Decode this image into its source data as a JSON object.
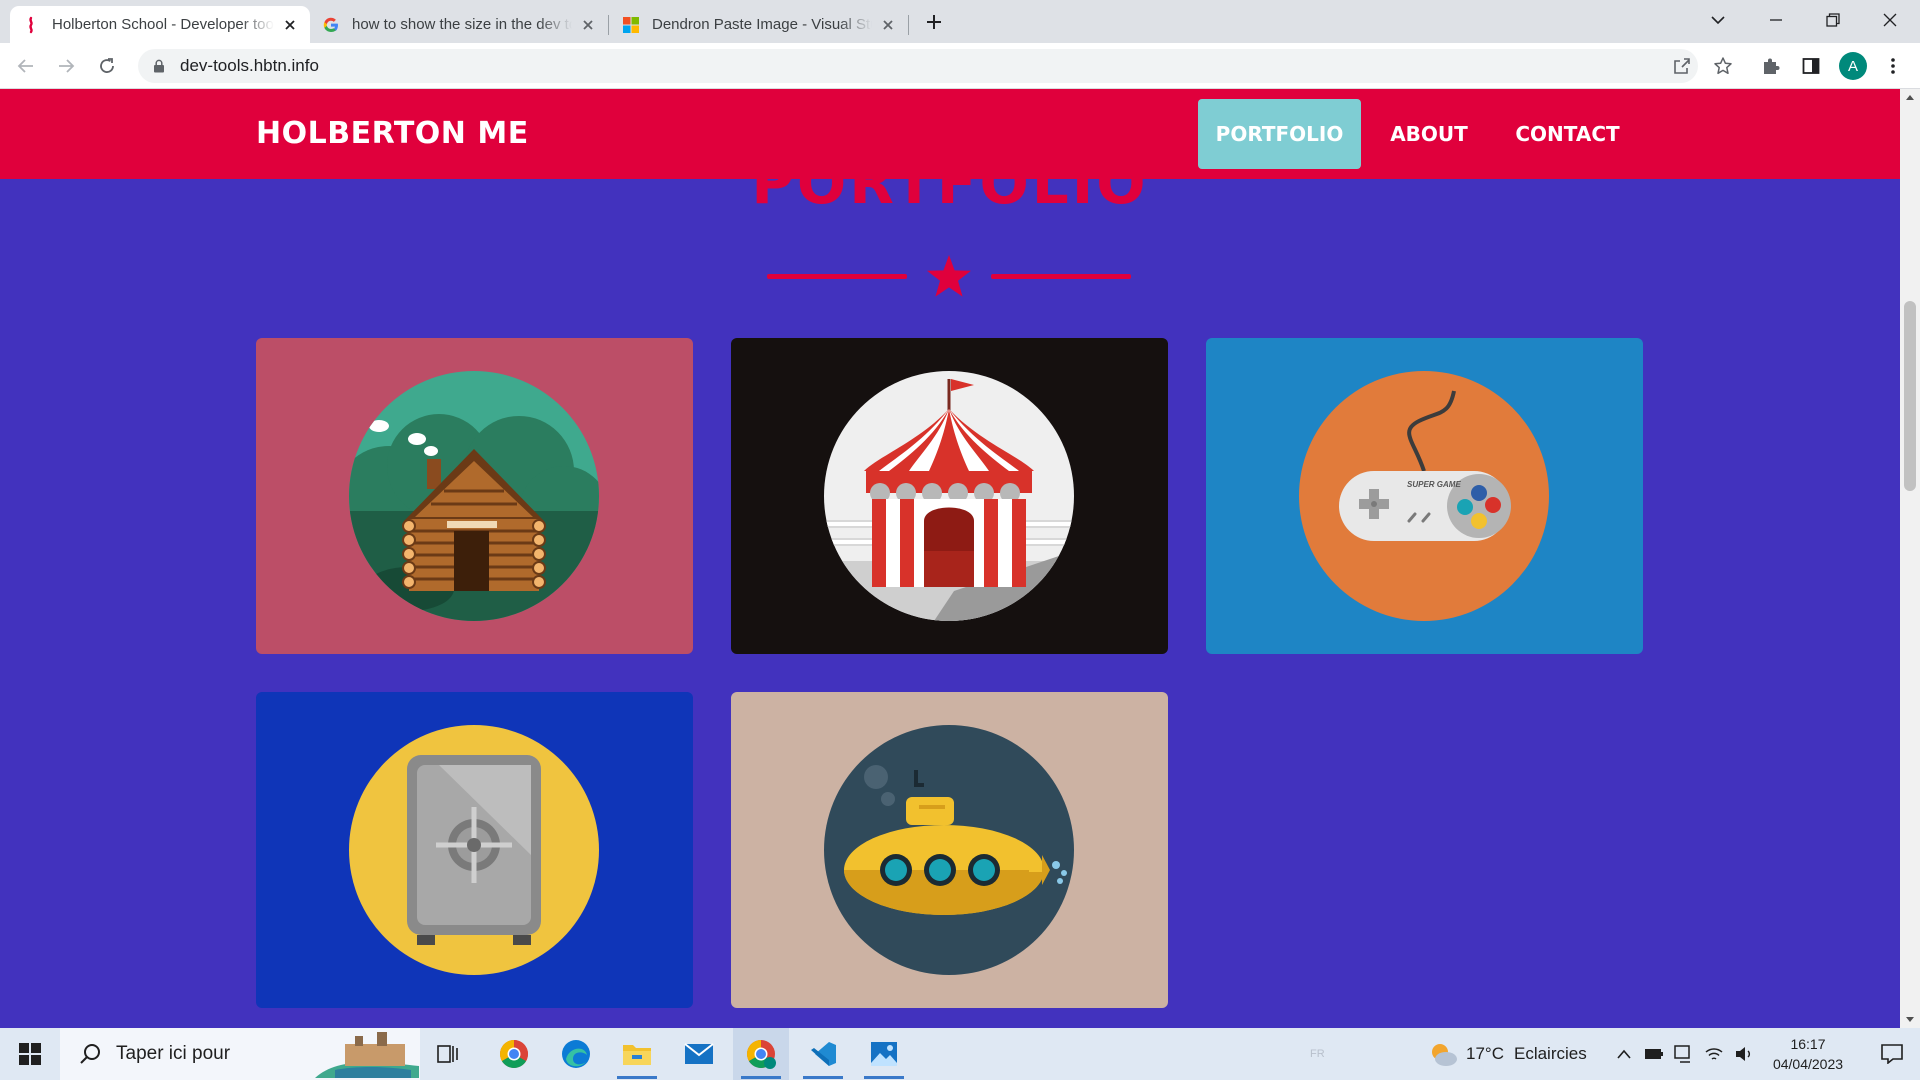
{
  "browser": {
    "tabs": [
      {
        "title": "Holberton School - Developer tools",
        "active": true
      },
      {
        "title": "how to show the size in the dev tools",
        "active": false
      },
      {
        "title": "Dendron Paste Image - Visual Studio",
        "active": false
      }
    ],
    "url": "dev-tools.hbtn.info",
    "profile_initial": "A"
  },
  "site": {
    "brand": "HOLBERTON ME",
    "nav": [
      {
        "label": "PORTFOLIO",
        "active": true
      },
      {
        "label": "ABOUT",
        "active": false
      },
      {
        "label": "CONTACT",
        "active": false
      }
    ],
    "section_title": "PORTFOLIO",
    "portfolio": [
      {
        "icon": "log-cabin-icon",
        "bg": "#bc4e67"
      },
      {
        "icon": "circus-tent-icon",
        "bg": "#15100f"
      },
      {
        "icon": "game-controller-icon",
        "bg": "#1e85c5",
        "text": "SUPER GAME"
      },
      {
        "icon": "safe-icon",
        "bg": "#0f35b8"
      },
      {
        "icon": "submarine-icon",
        "bg": "#ccb2a3"
      }
    ],
    "colors": {
      "header": "#e0003c",
      "page_bg": "#4232be",
      "active_nav": "#7fcdd3"
    }
  },
  "taskbar": {
    "search_placeholder": "Taper ici pour",
    "weather_temp": "17°C",
    "weather_desc": "Eclaircies",
    "time": "16:17",
    "date": "04/04/2023",
    "lang": "FR"
  }
}
